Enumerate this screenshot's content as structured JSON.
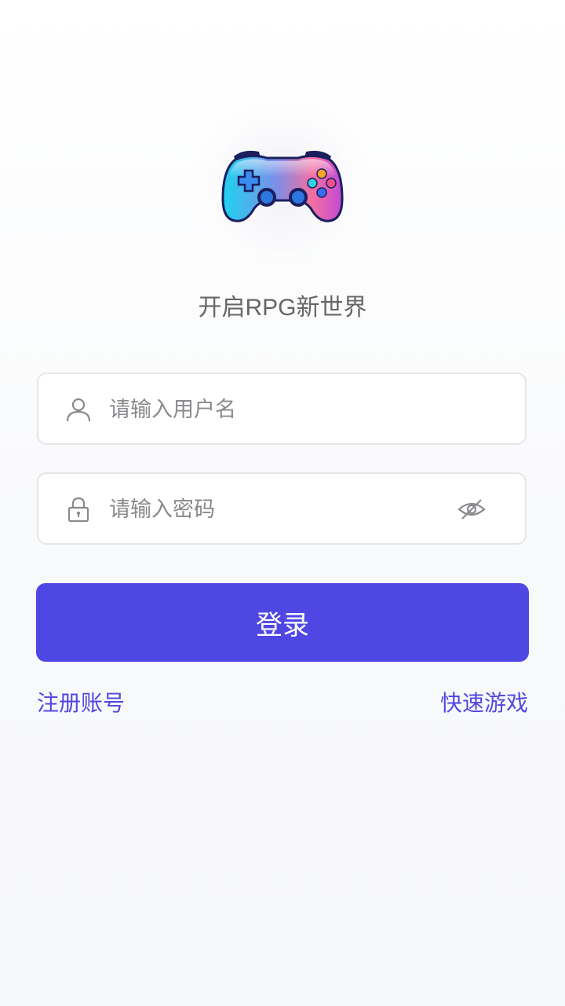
{
  "app": {
    "logo_icon": "gamepad-icon",
    "title": "开启RPG新世界",
    "accent_color": "#4f47e4"
  },
  "form": {
    "username": {
      "icon": "user-icon",
      "placeholder": "请输入用户名",
      "value": ""
    },
    "password": {
      "icon": "lock-icon",
      "placeholder": "请输入密码",
      "value": "",
      "toggle_icon": "eye-off-icon"
    },
    "login_label": "登录"
  },
  "links": {
    "register_label": "注册账号",
    "quick_play_label": "快速游戏"
  }
}
